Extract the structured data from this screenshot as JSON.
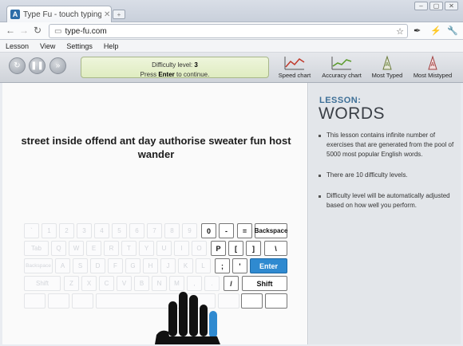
{
  "browser": {
    "tab_title": "Type Fu - touch typing tuto",
    "favicon_letter": "A",
    "url": "type-fu.com",
    "window_controls": [
      "minimize",
      "maximize",
      "close"
    ]
  },
  "menu": [
    "Lesson",
    "View",
    "Settings",
    "Help"
  ],
  "status": {
    "difficulty_prefix": "Difficulty level: ",
    "difficulty_value": "3",
    "press": "Press ",
    "enter": "Enter",
    "continue": " to continue."
  },
  "chart_buttons": {
    "speed": "Speed chart",
    "accuracy": "Accuracy chart",
    "most_typed": "Most Typed",
    "most_mistyped": "Most Mistyped"
  },
  "exercise_text": "street inside offend ant day authorise sweater fun host wander",
  "keyboard": {
    "row1": [
      "`",
      "1",
      "2",
      "3",
      "4",
      "5",
      "6",
      "7",
      "8",
      "9",
      "0",
      "-",
      "=",
      "Backspace"
    ],
    "row2": [
      "Tab",
      "Q",
      "W",
      "E",
      "R",
      "T",
      "Y",
      "U",
      "I",
      "O",
      "P",
      "[",
      "]",
      "\\"
    ],
    "row3": [
      "Backspace",
      "A",
      "S",
      "D",
      "F",
      "G",
      "H",
      "J",
      "K",
      "L",
      ";",
      "'",
      "Enter"
    ],
    "row4": [
      "Shift",
      "Z",
      "X",
      "C",
      "V",
      "B",
      "N",
      "M",
      ",",
      ".",
      "/",
      "Shift"
    ]
  },
  "lesson": {
    "label": "LESSON:",
    "name": "WORDS",
    "bullets": [
      "This lesson contains infinite number of exercises that are generated from the pool of 5000 most popular English words.",
      "There are 10 difficulty levels.",
      "Difficulty level will be automatically adjusted based on how well you perform."
    ]
  },
  "colors": {
    "enter_key": "#2f8ad0",
    "lesson_label": "#3d6f97",
    "status_bg": "#dfecc0"
  }
}
